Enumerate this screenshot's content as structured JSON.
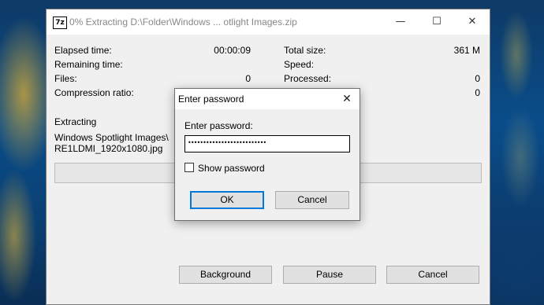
{
  "window": {
    "title": "0% Extracting D:\\Folder\\Windows  ... otlight Images.zip",
    "app_icon_text": "7z",
    "controls": {
      "minimize": "—",
      "maximize": "☐",
      "close": "✕"
    }
  },
  "stats": {
    "elapsed_label": "Elapsed time:",
    "elapsed_value": "00:00:09",
    "remaining_label": "Remaining time:",
    "remaining_value": "",
    "files_label": "Files:",
    "files_value": "0",
    "ratio_label": "Compression ratio:",
    "ratio_value": "",
    "total_size_label": "Total size:",
    "total_size_value": "361 M",
    "speed_label": "Speed:",
    "speed_value": "",
    "processed_label": "Processed:",
    "processed_value": "0",
    "packed_value": "0"
  },
  "extracting": {
    "label": "Extracting",
    "file_line1": "Windows Spotlight Images\\",
    "file_line2": "RE1LDMI_1920x1080.jpg",
    "progress_fraction": 0
  },
  "buttons": {
    "background": "Background",
    "pause": "Pause",
    "cancel": "Cancel"
  },
  "dialog": {
    "title": "Enter password",
    "close": "✕",
    "prompt": "Enter password:",
    "password_mask": "••••••••••••••••••••••••••",
    "show_password_label": "Show password",
    "show_password_checked": false,
    "ok_label": "OK",
    "cancel_label": "Cancel"
  }
}
